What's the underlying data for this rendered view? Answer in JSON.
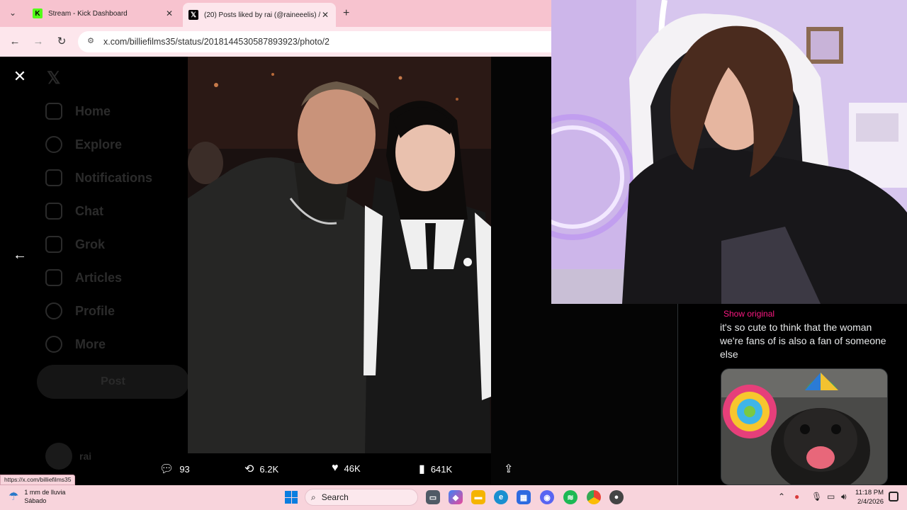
{
  "browser": {
    "tabs": [
      {
        "title": "Stream - Kick Dashboard",
        "icon": "kick-icon"
      },
      {
        "title": "(20) Posts liked by rai (@raineeelis) / X",
        "icon": "x-icon"
      }
    ],
    "url": "x.com/billiefilms35/status/2018144530587893923/photo/2"
  },
  "sidebar": {
    "items": [
      "Home",
      "Explore",
      "Notifications",
      "Chat",
      "Grok",
      "Articles",
      "Profile",
      "More"
    ],
    "post_label": "Post",
    "profile_name": "rai"
  },
  "actions": {
    "replies": "93",
    "reposts": "6.2K",
    "likes": "46K",
    "views": "641K"
  },
  "side_tweet": {
    "show_original": "Show original",
    "text": "it's so cute to think that the woman we're fans of is also a fan of someone else"
  },
  "status_url": "https://x.com/billiefilms35",
  "taskbar": {
    "weather_line1": "1 mm de lluvia",
    "weather_line2": "Sábado",
    "search_label": "Search",
    "time": "11:18 PM",
    "date": "2/4/2026"
  },
  "colors": {
    "tabbar": "#f7c3cf",
    "accent_pink": "#f91880",
    "kick_green": "#53fc18"
  }
}
